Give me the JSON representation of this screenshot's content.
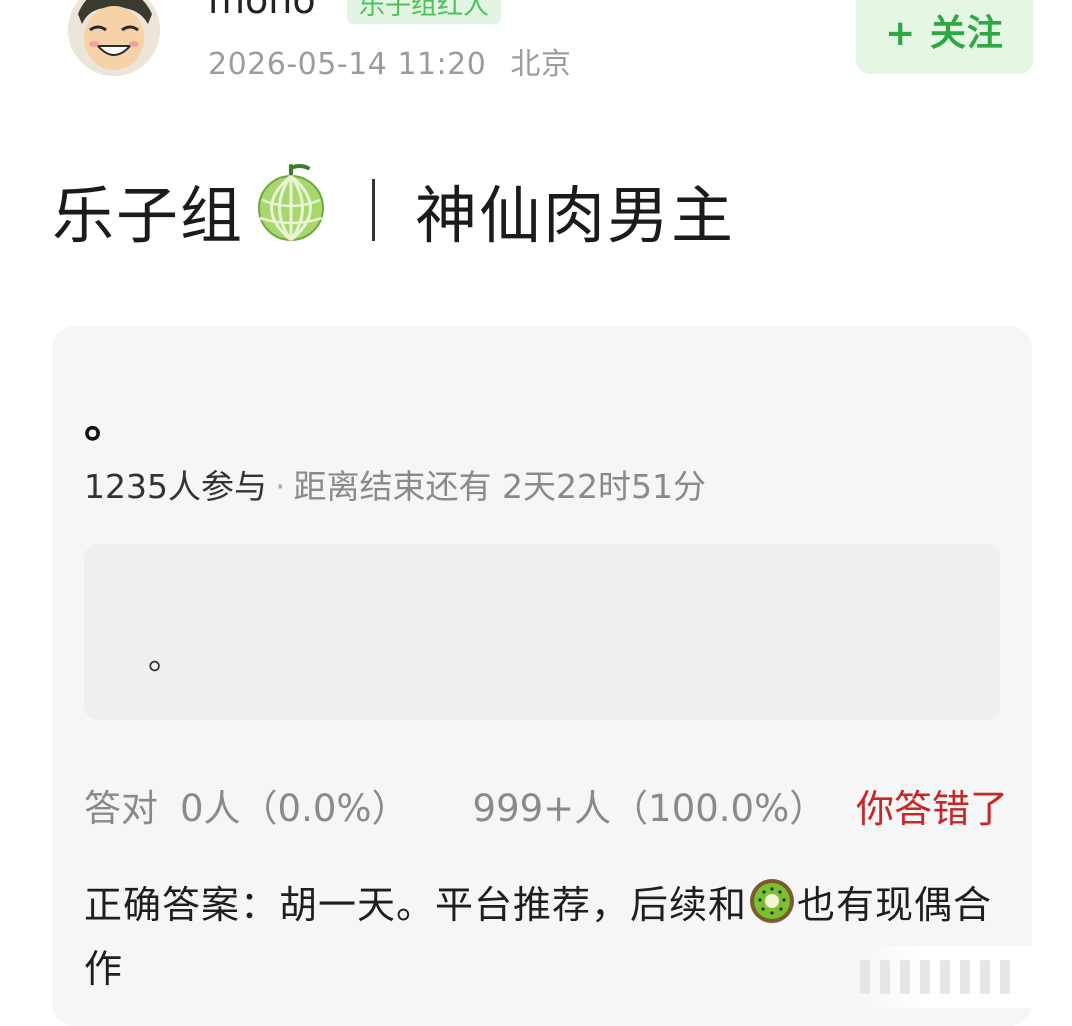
{
  "post": {
    "username": "mono",
    "user_tag": "乐子组红人",
    "timestamp": "2026-05-14 11:20",
    "location": "北京",
    "follow_label": "+ 关注",
    "title_left": "乐子组",
    "title_right": "神仙肉男主",
    "title_icon": "melon-emoji"
  },
  "quiz": {
    "question": "。",
    "participants": "1235人参与",
    "separator": "·",
    "remaining": "距离结束还有 2天22时51分",
    "option_text": "。",
    "correct_label": "答对",
    "correct_count": "0人（0.0%）",
    "wrong_count": "999+人（100.0%）",
    "your_result": "你答错了",
    "answer_prefix": "正确答案：胡一天。平台推荐，后续和",
    "answer_icon": "kiwi-emoji",
    "answer_suffix": "也有现偶合作"
  },
  "colors": {
    "accent_green": "#2fa843",
    "tag_green": "#49c25a",
    "wrong_red": "#c62828"
  }
}
